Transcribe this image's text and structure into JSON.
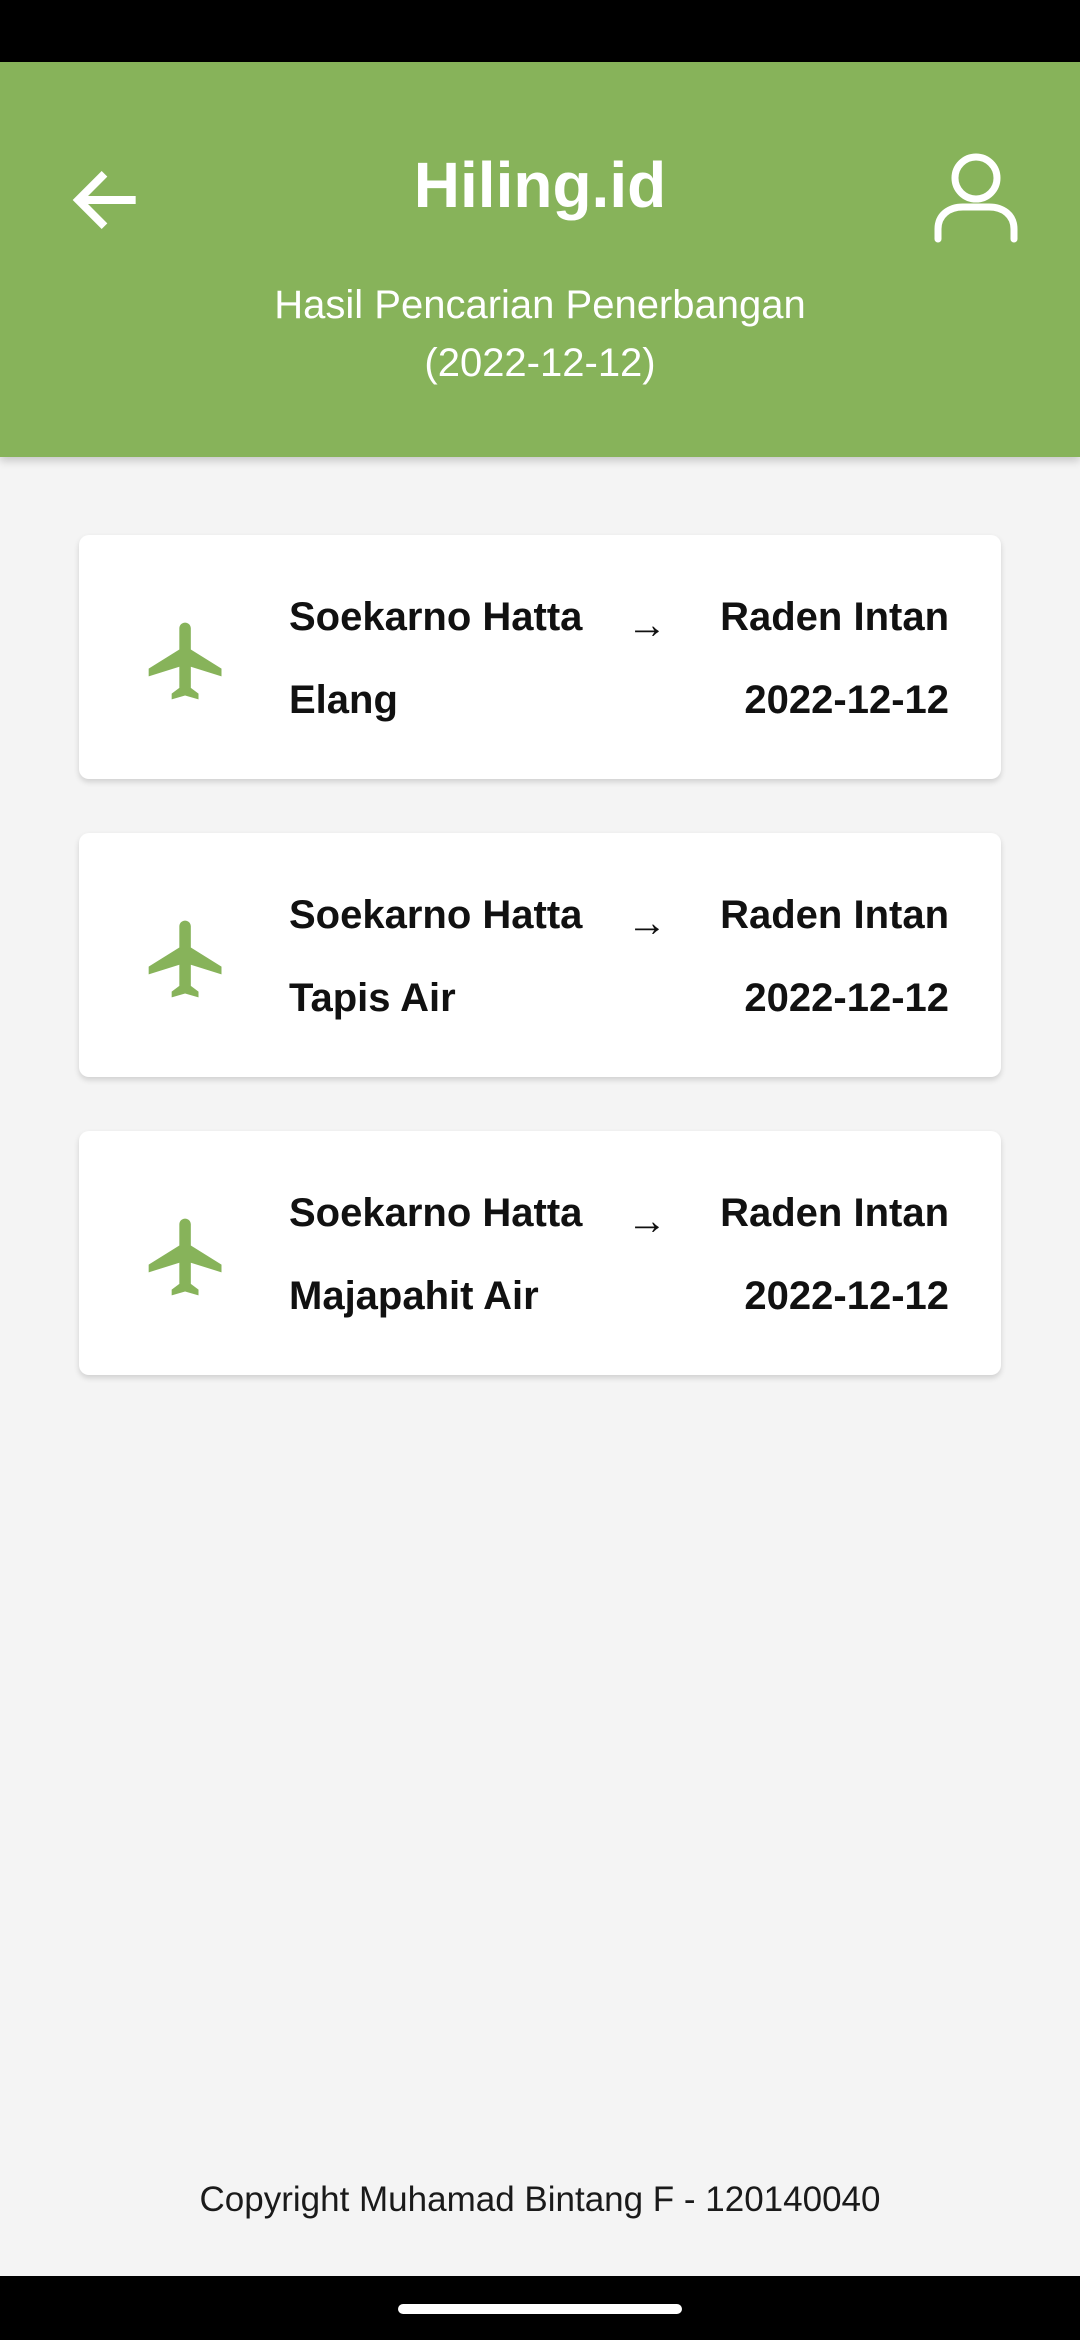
{
  "header": {
    "title": "Hiling.id",
    "subtitle_line1": "Hasil Pencarian Penerbangan",
    "subtitle_line2": "(2022-12-12)",
    "back_icon": "arrow-left-icon",
    "profile_icon": "user-icon"
  },
  "flights": [
    {
      "from": "Soekarno Hatta",
      "to": "Raden Intan",
      "airline": "Elang",
      "date": "2022-12-12",
      "arrow": "→"
    },
    {
      "from": "Soekarno Hatta",
      "to": "Raden Intan",
      "airline": "Tapis Air",
      "date": "2022-12-12",
      "arrow": "→"
    },
    {
      "from": "Soekarno Hatta",
      "to": "Raden Intan",
      "airline": "Majapahit Air",
      "date": "2022-12-12",
      "arrow": "→"
    }
  ],
  "footer": {
    "copyright": "Copyright Muhamad Bintang F - 120140040"
  },
  "colors": {
    "accent": "#87b35a",
    "background": "#f4f4f4",
    "card": "#ffffff"
  }
}
